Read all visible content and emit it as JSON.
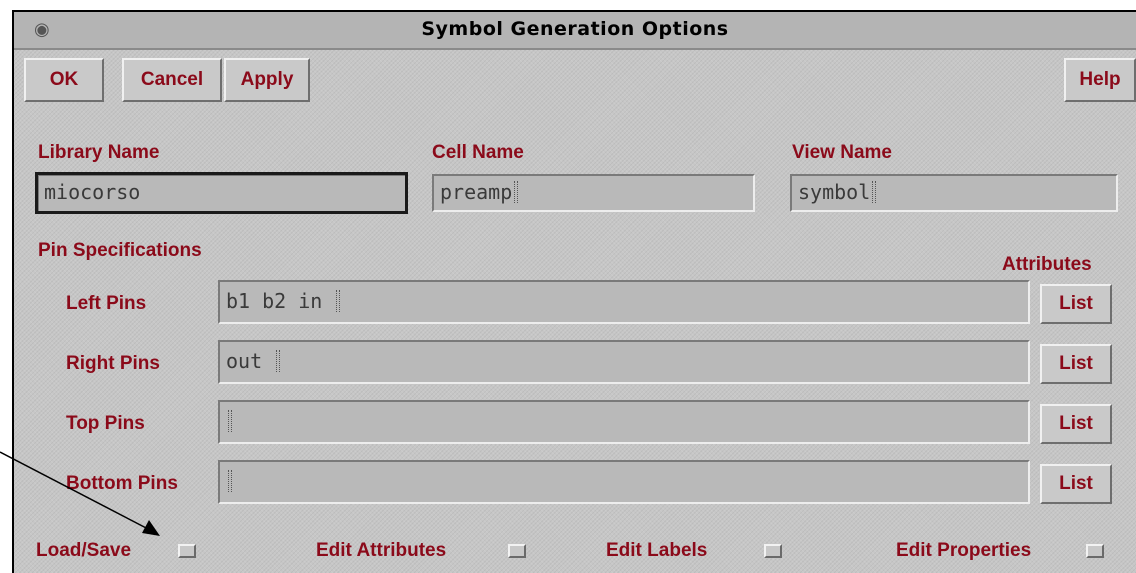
{
  "window": {
    "title": "Symbol Generation Options",
    "icon": "app-icon"
  },
  "toolbar": {
    "ok_label": "OK",
    "cancel_label": "Cancel",
    "apply_label": "Apply",
    "help_label": "Help"
  },
  "names": {
    "library_label": "Library Name",
    "library_value": "miocorso",
    "cell_label": "Cell Name",
    "cell_value": "preamp",
    "view_label": "View Name",
    "view_value": "symbol"
  },
  "pins": {
    "section_label": "Pin Specifications",
    "attributes_label": "Attributes",
    "rows": [
      {
        "label": "Left Pins",
        "value": "b1 b2 in ",
        "list_label": "List"
      },
      {
        "label": "Right Pins",
        "value": "out ",
        "list_label": "List"
      },
      {
        "label": "Top Pins",
        "value": "",
        "list_label": "List"
      },
      {
        "label": "Bottom Pins",
        "value": "",
        "list_label": "List"
      }
    ]
  },
  "options": {
    "load_save_label": "Load/Save",
    "edit_attributes_label": "Edit Attributes",
    "edit_labels_label": "Edit Labels",
    "edit_properties_label": "Edit Properties"
  },
  "colors": {
    "label_color": "#8b0a1a",
    "panel_bg": "#c6c6c6"
  }
}
